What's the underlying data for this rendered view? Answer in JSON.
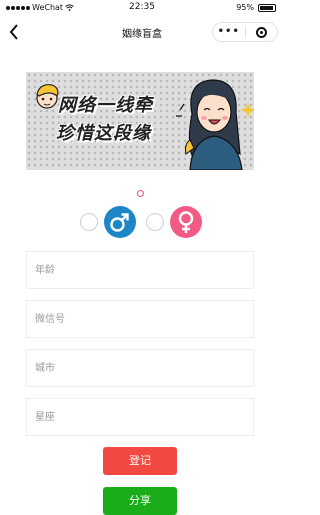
{
  "status_bar": {
    "carrier": "WeChat",
    "time": "22:35",
    "battery": "95%",
    "battery_level": 0.95
  },
  "nav": {
    "title": "姻缘盲盒",
    "more_label": "•••"
  },
  "banner": {
    "line1": "网络一线牵",
    "line2": "珍惜这段缘"
  },
  "form": {
    "age_placeholder": "年龄",
    "wechat_placeholder": "微信号",
    "city_placeholder": "城市",
    "zodiac_placeholder": "星座"
  },
  "gender": {
    "male_symbol": "♂",
    "female_symbol": "♀",
    "male_color": "#1c86c6",
    "female_color": "#f25b84"
  },
  "buttons": {
    "register_label": "登记",
    "share_label": "分享"
  },
  "colors": {
    "register": "#f24a43",
    "share": "#1aad19",
    "indicator": "#e0566b"
  }
}
